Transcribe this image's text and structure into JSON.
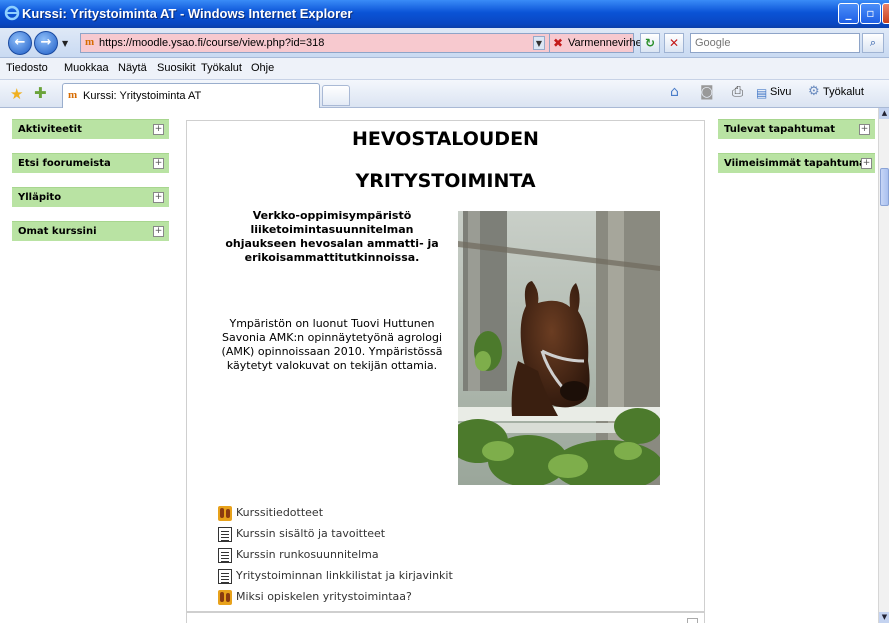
{
  "window": {
    "title": "Kurssi: Yritystoiminta AT - Windows Internet Explorer",
    "controls": {
      "minimize": "_",
      "maximize": "▫",
      "close": "✕"
    }
  },
  "address_bar": {
    "url": "https://moodle.ysao.fi/course/view.php?id=318",
    "certificate_label": "Varmennevirhe",
    "search_placeholder": "Google"
  },
  "menu": [
    "Tiedosto",
    "Muokkaa",
    "Näytä",
    "Suosikit",
    "Työkalut",
    "Ohje"
  ],
  "tab": {
    "label": "Kurssi: Yritystoiminta AT"
  },
  "command_bar": {
    "page_label": "Sivu",
    "tools_label": "Työkalut"
  },
  "left_blocks": [
    {
      "label": "Aktiviteetit",
      "toggle": "+"
    },
    {
      "label": "Etsi foorumeista",
      "toggle": "+"
    },
    {
      "label": "Ylläpito",
      "toggle": "+"
    },
    {
      "label": "Omat kurssini",
      "toggle": "+"
    }
  ],
  "right_blocks": [
    {
      "label": "Tulevat tapahtumat",
      "toggle": "+"
    },
    {
      "label": "Viimeisimmät tapahtumat",
      "toggle": "+"
    }
  ],
  "main": {
    "heading_line1": "HEVOSTALOUDEN",
    "heading_line2": "YRITYSTOIMINTA",
    "intro": "Verkko-oppimisympäristö liiketoimintasuunnitelman ohjaukseen  hevosalan ammatti- ja erikoisammattitutkinnoissa.",
    "credit": "Ympäristön on luonut Tuovi Huttunen Savonia AMK:n opinnäytetyönä agrologi (AMK) opinnoissaan 2010. Ympäristössä käytetyt valokuvat on tekijän ottamia.",
    "resources": [
      {
        "label": "Kurssitiedotteet",
        "icon": "forum-icon"
      },
      {
        "label": "Kurssin sisältö ja tavoitteet",
        "icon": "file-icon"
      },
      {
        "label": "Kurssin runkosuunnitelma",
        "icon": "file-icon"
      },
      {
        "label": "Yritystoiminnan linkkilistat ja kirjavinkit",
        "icon": "file-icon"
      },
      {
        "label": "Miksi opiskelen yritystoimintaa?",
        "icon": "forum-icon"
      }
    ]
  },
  "colors": {
    "block_header": "#b9e3a3",
    "titlebar": "#0a53d6",
    "address_error": "#f7c9cf"
  }
}
